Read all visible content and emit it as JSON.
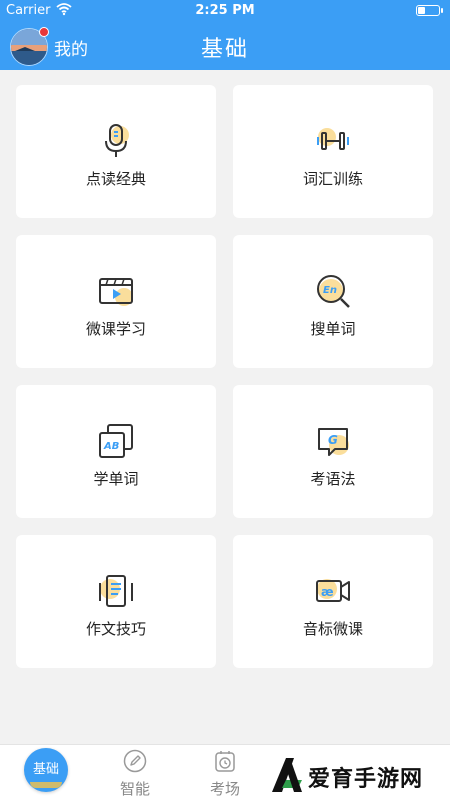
{
  "status_bar": {
    "carrier": "Carrier",
    "time": "2:25 PM"
  },
  "nav": {
    "mine_label": "我的",
    "title": "基础"
  },
  "cards": [
    {
      "label": "点读经典",
      "icon": "microphone-icon"
    },
    {
      "label": "词汇训练",
      "icon": "dumbbell-icon"
    },
    {
      "label": "微课学习",
      "icon": "video-player-icon"
    },
    {
      "label": "搜单词",
      "icon": "search-en-icon"
    },
    {
      "label": "学单词",
      "icon": "ab-cards-icon"
    },
    {
      "label": "考语法",
      "icon": "grammar-bubble-icon"
    },
    {
      "label": "作文技巧",
      "icon": "document-icon"
    },
    {
      "label": "音标微课",
      "icon": "phonetic-camera-icon"
    }
  ],
  "tabs": [
    {
      "label": "基础",
      "icon": "home-icon",
      "active": true
    },
    {
      "label": "智能",
      "icon": "pencil-icon"
    },
    {
      "label": "考场",
      "icon": "clock-icon"
    }
  ],
  "watermark": {
    "text": "爱育手游网"
  },
  "colors": {
    "primary": "#3b9ef5",
    "accent": "#f5c24a",
    "card_bg": "#ffffff",
    "page_bg": "#f2f2f2",
    "icon_stroke": "#333333",
    "badge": "#e8373a"
  }
}
